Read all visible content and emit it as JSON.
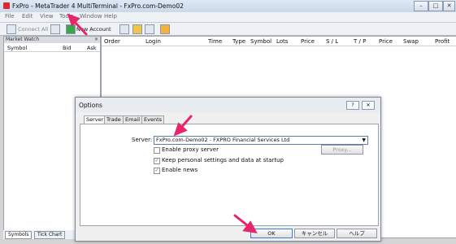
{
  "window": {
    "title": "FxPro - MetaTrader 4 MultiTerminal - FxPro.com-Demo02",
    "controls": [
      "–",
      "□",
      "✕"
    ]
  },
  "menu": [
    "File",
    "Edit",
    "View",
    "Tools",
    "Window",
    "Help"
  ],
  "toolbar": {
    "connect_all": "Connect All",
    "new_account": "New Account"
  },
  "market_watch": {
    "title": "Market Watch",
    "columns": [
      "Symbol",
      "Bid",
      "Ask"
    ],
    "tabs": [
      "Symbols",
      "Tick Chart"
    ]
  },
  "terminal": {
    "columns": [
      "Order",
      "Login",
      "Time",
      "Type",
      "Symbol",
      "Lots",
      "Price",
      "S / L",
      "T / P",
      "Price",
      "Swap",
      "Profit"
    ]
  },
  "dialog": {
    "title": "Options",
    "help_button": "?",
    "close_button": "✕",
    "tabs": [
      "Server",
      "Trade",
      "Email",
      "Events"
    ],
    "server_label": "Server:",
    "server_value": "FxPro.com-Demo02 - FXPRO Financial Services Ltd",
    "options": [
      {
        "label": "Enable proxy server",
        "checked": false
      },
      {
        "label": "Keep personal settings and data at startup",
        "checked": true
      },
      {
        "label": "Enable news",
        "checked": true
      }
    ],
    "proxy_button": "Proxy...",
    "ok_button": "OK",
    "cancel_button": "キャンセル",
    "help_label": "ヘルプ"
  },
  "colors": {
    "annotation_arrow": "#e8246b",
    "primary_border": "#3d7bd1"
  }
}
